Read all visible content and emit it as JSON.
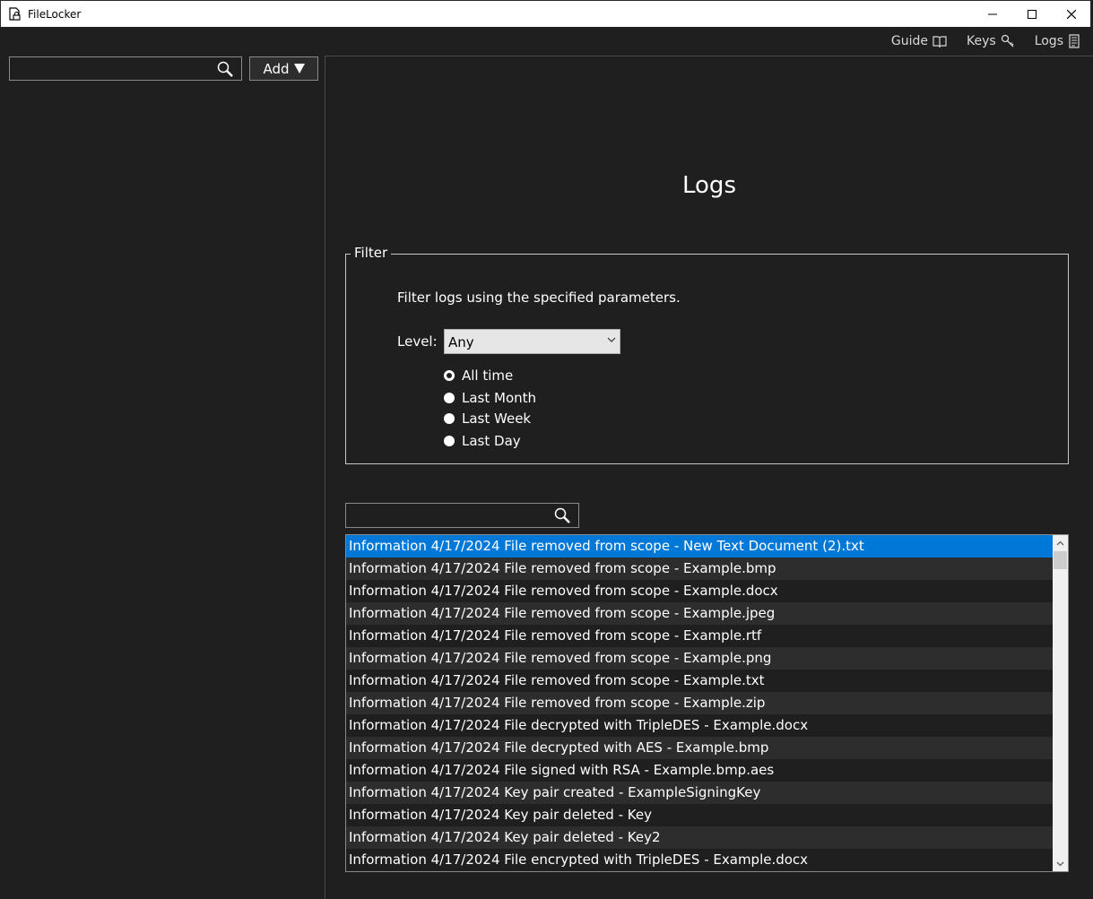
{
  "window": {
    "title": "FileLocker",
    "controls": [
      "minimize",
      "maximize",
      "close"
    ]
  },
  "nav": {
    "guide": "Guide",
    "keys": "Keys",
    "logs": "Logs"
  },
  "sidebar": {
    "search_value": "",
    "add_label": "Add"
  },
  "page": {
    "title": "Logs"
  },
  "filter": {
    "legend": "Filter",
    "description": "Filter logs using the specified parameters.",
    "level_label": "Level:",
    "level_value": "Any",
    "time_options": [
      {
        "label": "All time",
        "checked": true
      },
      {
        "label": "Last Month",
        "checked": false
      },
      {
        "label": "Last Week",
        "checked": false
      },
      {
        "label": "Last Day",
        "checked": false
      }
    ]
  },
  "log_search_value": "",
  "logs": [
    "Information 4/17/2024 File removed from scope - New Text Document (2).txt",
    "Information 4/17/2024 File removed from scope - Example.bmp",
    "Information 4/17/2024 File removed from scope - Example.docx",
    "Information 4/17/2024 File removed from scope - Example.jpeg",
    "Information 4/17/2024 File removed from scope - Example.rtf",
    "Information 4/17/2024 File removed from scope - Example.png",
    "Information 4/17/2024 File removed from scope - Example.txt",
    "Information 4/17/2024 File removed from scope - Example.zip",
    "Information 4/17/2024 File decrypted with TripleDES - Example.docx",
    "Information 4/17/2024 File decrypted with AES  - Example.bmp",
    "Information 4/17/2024 File signed with RSA - Example.bmp.aes",
    "Information 4/17/2024 Key pair created - ExampleSigningKey",
    "Information 4/17/2024 Key pair deleted - Key",
    "Information 4/17/2024 Key pair deleted - Key2",
    "Information 4/17/2024 File encrypted with TripleDES - Example.docx"
  ],
  "selected_log_index": 0,
  "colors": {
    "background": "#1f1f1f",
    "row_alt": "#2d2d2d",
    "selection": "#0078d7"
  }
}
